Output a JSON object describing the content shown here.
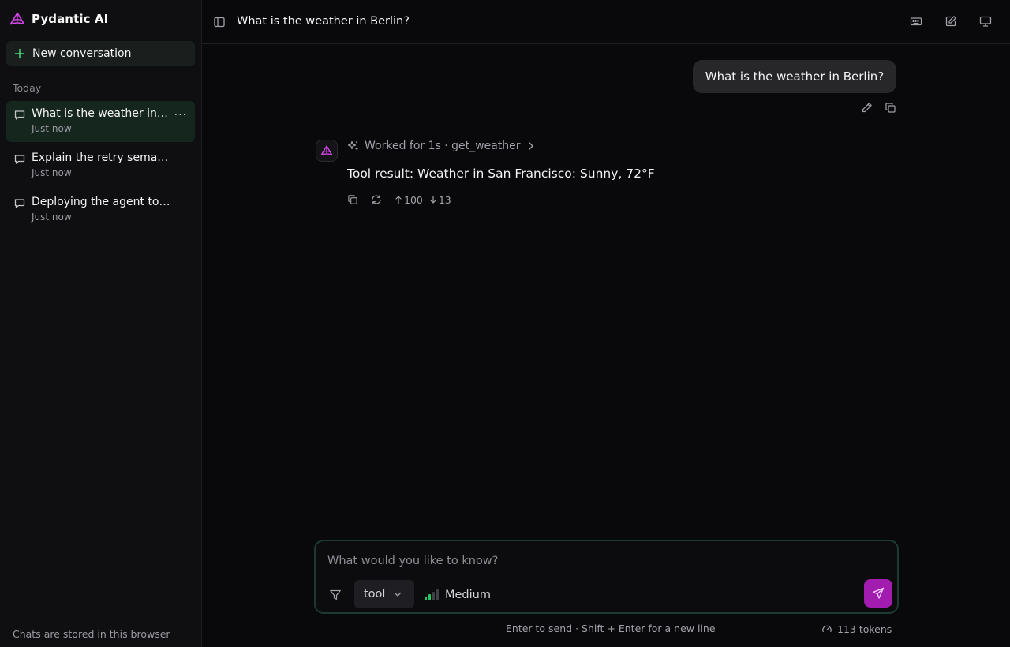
{
  "app": {
    "name": "Pydantic AI",
    "brand_color": "#d946ef",
    "accent_color": "#a21caf"
  },
  "sidebar": {
    "new_conversation_label": "New conversation",
    "section_label": "Today",
    "conversations": [
      {
        "title": "What is the weather in Berlin?",
        "time": "Just now",
        "active": true
      },
      {
        "title": "Explain the retry semantics",
        "time": "Just now",
        "active": false
      },
      {
        "title": "Deploying the agent to production",
        "time": "Just now",
        "active": false
      }
    ],
    "more_label": "···",
    "footer": "Chats are stored in this browser"
  },
  "header": {
    "title": "What is the weather in Berlin?",
    "icons": [
      "sidebar-toggle-icon",
      "keyboard-icon",
      "edit-icon",
      "monitor-icon"
    ]
  },
  "chat": {
    "user_message": "What is the weather in Berlin?",
    "worked_summary": "Worked for 1s · get_weather",
    "tool_result": "Tool result: Weather in San Francisco: Sunny, 72°F",
    "tokens_in": "100",
    "tokens_out": "13"
  },
  "composer": {
    "placeholder": "What would you like to know?",
    "model_value": "tool",
    "effort_label": "Medium",
    "effort_level": 0.5,
    "hint": "Enter to send · Shift + Enter for a new line",
    "token_count": "113 tokens"
  }
}
